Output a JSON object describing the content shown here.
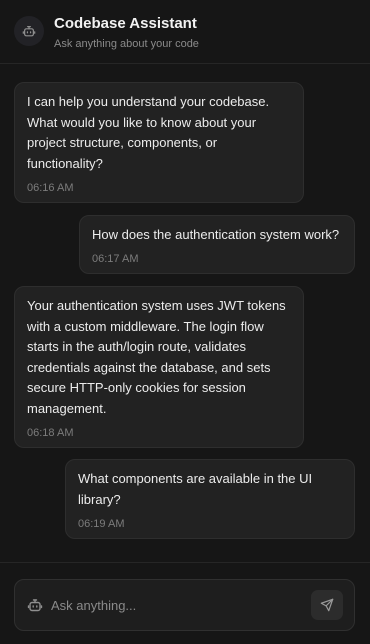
{
  "header": {
    "title": "Codebase Assistant",
    "subtitle": "Ask anything about your code",
    "avatar_icon": "bot-icon"
  },
  "messages": [
    {
      "role": "assistant",
      "text": "I can help you understand your codebase. What would you like to know about your project structure, components, or functionality?",
      "time": "06:16 AM"
    },
    {
      "role": "user",
      "text": "How does the authentication system work?",
      "time": "06:17 AM"
    },
    {
      "role": "assistant",
      "text": "Your authentication system uses JWT tokens with a custom middleware. The login flow starts in the auth/login route, validates credentials against the database, and sets secure HTTP-only cookies for session management.",
      "time": "06:18 AM"
    },
    {
      "role": "user",
      "text": "What components are available in the UI library?",
      "time": "06:19 AM"
    }
  ],
  "composer": {
    "placeholder": "Ask anything...",
    "value": "",
    "leading_icon": "bot-icon",
    "send_icon": "send-icon"
  },
  "colors": {
    "background": "#161616",
    "bubble": "#222222",
    "bubble_border": "#2e2e2e",
    "text": "#ececec",
    "muted": "#7c7c7c"
  }
}
